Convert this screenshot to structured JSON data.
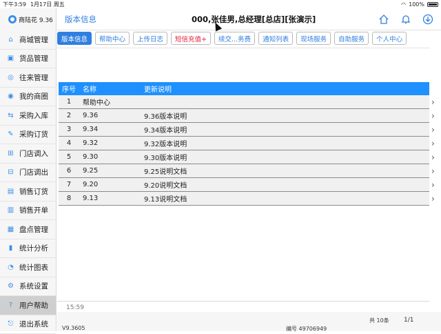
{
  "status_bar": {
    "time": "下午3:59",
    "date": "1月17日 周五",
    "battery": "100%"
  },
  "app": {
    "brand": "商陆花 9.36"
  },
  "sidebar": {
    "items": [
      {
        "label": "商城管理",
        "icon": "store-icon"
      },
      {
        "label": "货品管理",
        "icon": "box-icon"
      },
      {
        "label": "往来管理",
        "icon": "contacts-icon"
      },
      {
        "label": "我的商圈",
        "icon": "circle-icon"
      },
      {
        "label": "采购入库",
        "icon": "purchase-icon"
      },
      {
        "label": "采购订货",
        "icon": "edit-icon"
      },
      {
        "label": "门店调入",
        "icon": "transfer-in-icon"
      },
      {
        "label": "门店调出",
        "icon": "transfer-out-icon"
      },
      {
        "label": "销售订货",
        "icon": "sales-order-icon"
      },
      {
        "label": "销售开单",
        "icon": "invoice-icon"
      },
      {
        "label": "盘点管理",
        "icon": "inventory-icon"
      },
      {
        "label": "统计分析",
        "icon": "bar-chart-icon"
      },
      {
        "label": "统计图表",
        "icon": "pie-chart-icon"
      },
      {
        "label": "系统设置",
        "icon": "gear-icon"
      },
      {
        "label": "用户帮助",
        "icon": "help-icon"
      },
      {
        "label": "退出系统",
        "icon": "logout-icon"
      }
    ],
    "active_index": 14
  },
  "header": {
    "page_name": "版本信息",
    "title": "000,张佳男,总经理[总店][张演示]"
  },
  "tabs": [
    {
      "label": "版本信息"
    },
    {
      "label": "帮助中心"
    },
    {
      "label": "上传日志"
    },
    {
      "label": "短信充值+"
    },
    {
      "label": "续交...务费"
    },
    {
      "label": "通知列表"
    },
    {
      "label": "现场服务"
    },
    {
      "label": "自助服务"
    },
    {
      "label": "个人中心"
    }
  ],
  "table": {
    "headers": [
      "序号",
      "名称",
      "更新说明"
    ],
    "rows": [
      [
        "1",
        "帮助中心",
        ""
      ],
      [
        "2",
        "9.36",
        "9.36版本说明"
      ],
      [
        "3",
        "9.34",
        "9.34版本说明"
      ],
      [
        "4",
        "9.32",
        "9.32版本说明"
      ],
      [
        "5",
        "9.30",
        "9.30版本说明"
      ],
      [
        "6",
        "9.25",
        "9.25说明文档"
      ],
      [
        "7",
        "9.20",
        "9.20说明文档"
      ],
      [
        "8",
        "9.13",
        "9.13说明文档"
      ]
    ]
  },
  "footer": {
    "time": "15:59",
    "version": "V9.3605",
    "code": "编号 49706949",
    "count": "共 10条",
    "page": "1/1"
  },
  "colors": {
    "accent": "#2f7fe0",
    "table_header": "#1e90ff",
    "warn": "#e0203c"
  }
}
